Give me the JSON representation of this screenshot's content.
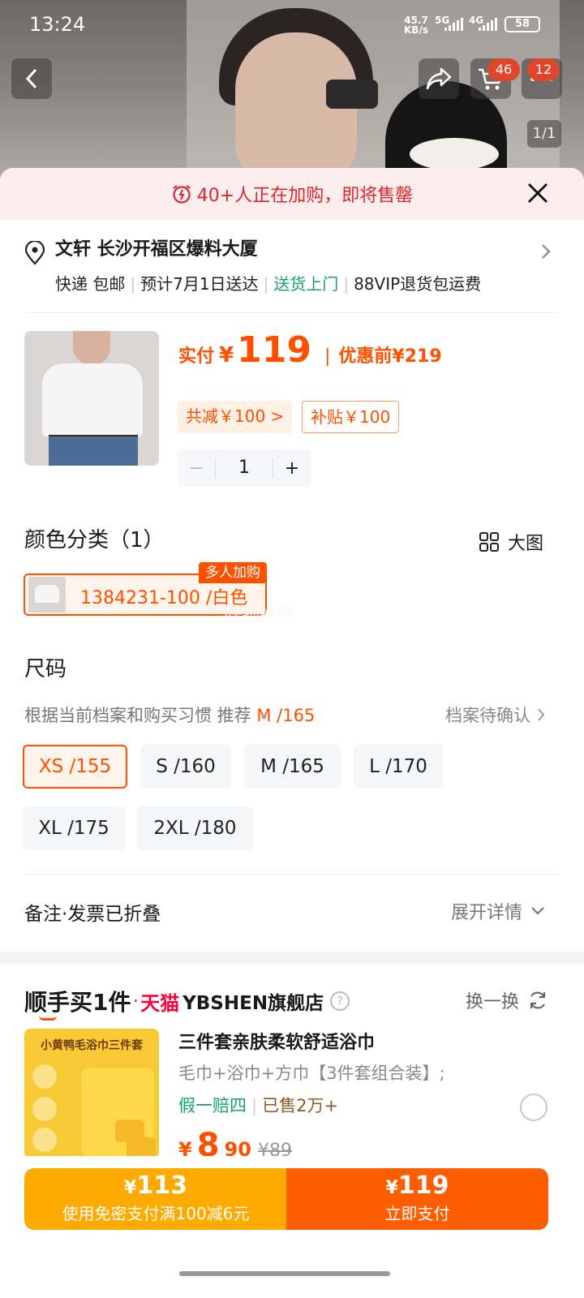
{
  "status_bar": {
    "time": "13:24",
    "net_speed": "45.7",
    "net_unit": "KB/s",
    "sig1": "5G",
    "sig2": "4G",
    "battery": "58"
  },
  "header": {
    "cart_badge": "46",
    "msg_badge": "12",
    "pager": "1/1"
  },
  "alert": {
    "text": "40+人正在加购，即将售罄"
  },
  "address": {
    "name": "文轩 长沙开福区爆料大厦",
    "shipping": "快递 包邮",
    "eta": "预计7月1日送达",
    "door": "送货上门",
    "vip": "88VIP退货包运费"
  },
  "product": {
    "pay_label": "实付",
    "currency": "¥",
    "price": "119",
    "before_label": "优惠前",
    "before_price": "¥219",
    "discount_tag": "共减￥100 >",
    "subsidy_tag": "补贴￥100",
    "quantity": "1",
    "minus": "−",
    "plus": "+"
  },
  "color": {
    "title": "颜色分类（1）",
    "bigpic": "大图",
    "option": "1384231-100 /白色",
    "hot": "多人加购",
    "watermark": "好物推推"
  },
  "size": {
    "title": "尺码",
    "recommend_prefix": "根据当前档案和购买习惯 推荐",
    "recommend_value": "M /165",
    "profile": "档案待确认",
    "options": [
      "XS /155",
      "S /160",
      "M /165",
      "L /170",
      "XL /175",
      "2XL /180"
    ],
    "selected": "XS /155"
  },
  "note": {
    "label": "备注·发票已折叠",
    "expand": "展开详情"
  },
  "addon": {
    "title": "顺手买1件",
    "dot": "·",
    "tmall": "天猫",
    "store": "YBSHEN旗舰店",
    "q": "?",
    "swap": "换一换",
    "image_caption": "小黄鸭毛浴巾三件套",
    "item_title": "三件套亲肤柔软舒适浴巾",
    "item_sub": "毛巾+浴巾+方巾【3件套组合装】;",
    "guarantee": "假一赔四",
    "sold": "已售2万+",
    "currency": "¥",
    "price_int": "8",
    "price_dec": "90",
    "orig_price": "¥89"
  },
  "pay": {
    "left_cur": "¥",
    "left_amt": "113",
    "left_sub": "使用免密支付满100减6元",
    "right_cur": "¥",
    "right_amt": "119",
    "right_sub": "立即支付"
  },
  "colors": {
    "accent": "#ff5000",
    "green": "#12a36a",
    "alert_red": "#e0242e",
    "pay_yellow": "#ffaa00",
    "pay_orange": "#ff5e00"
  }
}
